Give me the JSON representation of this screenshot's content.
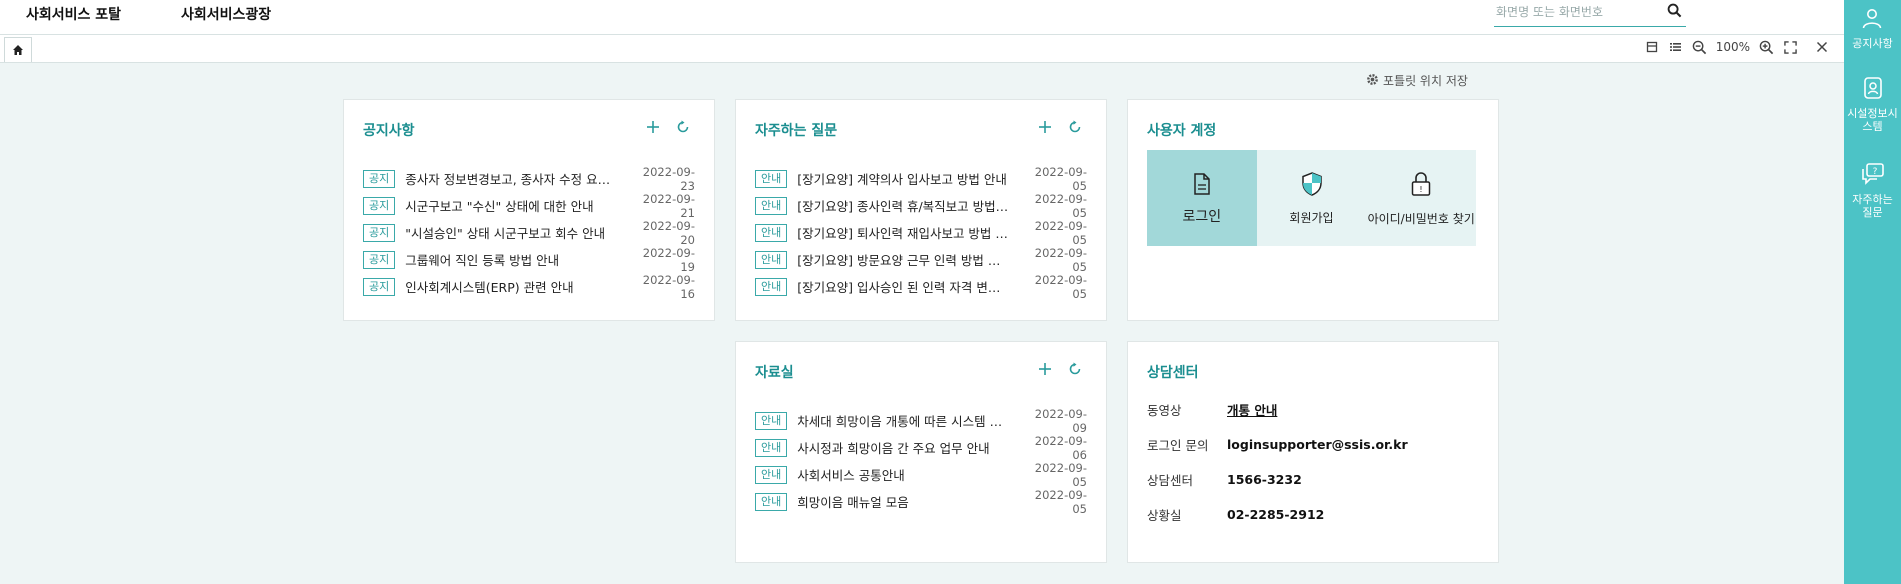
{
  "topnav": {
    "portal": "사회서비스 포탈",
    "plaza": "사회서비스광장"
  },
  "search": {
    "placeholder": "화면명 또는 화면번호",
    "value": ""
  },
  "toolbar": {
    "zoom": "100%"
  },
  "portlet": {
    "save_position": "포틀릿 위치 저장"
  },
  "rail": {
    "items": [
      {
        "label": "공지사항",
        "icon": "person-icon"
      },
      {
        "label": "시설정보시스템",
        "icon": "id-badge-icon"
      },
      {
        "label": "자주하는 질문",
        "icon": "chat-question-icon"
      }
    ]
  },
  "notices": {
    "title": "공지사항",
    "items": [
      {
        "badge": "공지",
        "text": "종사자 정보변경보고, 종사자 수정 요청 처리 안내",
        "date": "2022-09-23"
      },
      {
        "badge": "공지",
        "text": "시군구보고 \"수신\" 상태에 대한 안내",
        "date": "2022-09-21"
      },
      {
        "badge": "공지",
        "text": "\"시설승인\" 상태 시군구보고 회수 안내",
        "date": "2022-09-20"
      },
      {
        "badge": "공지",
        "text": "그룹웨어 직인 등록 방법 안내",
        "date": "2022-09-19"
      },
      {
        "badge": "공지",
        "text": "인사회계시스템(ERP) 관련 안내",
        "date": "2022-09-16"
      }
    ]
  },
  "faq": {
    "title": "자주하는 질문",
    "items": [
      {
        "badge": "안내",
        "text": "[장기요양] 계약의사 입사보고 방법 안내",
        "date": "2022-09-05"
      },
      {
        "badge": "안내",
        "text": "[장기요양] 종사인력 휴/복직보고 방법 안내",
        "date": "2022-09-05"
      },
      {
        "badge": "안내",
        "text": "[장기요양] 퇴사인력 재입사보고 방법 안내",
        "date": "2022-09-05"
      },
      {
        "badge": "안내",
        "text": "[장기요양] 방문요양 근무 인력 방법 안내",
        "date": "2022-09-05"
      },
      {
        "badge": "안내",
        "text": "[장기요양] 입사승인 된 인력 자격 변경 안내",
        "date": "2022-09-05"
      }
    ]
  },
  "account": {
    "title": "사용자 계정",
    "buttons": [
      {
        "label": "로그인",
        "icon": "document-icon"
      },
      {
        "label": "회원가입",
        "icon": "shield-icon"
      },
      {
        "label": "아이디/비밀번호 찾기",
        "icon": "lock-icon"
      }
    ]
  },
  "library": {
    "title": "자료실",
    "items": [
      {
        "badge": "안내",
        "text": "차세대 희망이음 개통에 따른 시스템 안내",
        "date": "2022-09-09"
      },
      {
        "badge": "안내",
        "text": "사시정과 희망이음 간 주요 업무 안내",
        "date": "2022-09-06"
      },
      {
        "badge": "안내",
        "text": "사회서비스 공통안내",
        "date": "2022-09-05"
      },
      {
        "badge": "안내",
        "text": "희망이음 매뉴얼 모음",
        "date": "2022-09-05"
      }
    ]
  },
  "center": {
    "title": "상담센터",
    "rows": [
      {
        "label": "동영상",
        "value": "개통 안내"
      },
      {
        "label": "로그인 문의",
        "value": "loginsupporter@ssis.or.kr"
      },
      {
        "label": "상담센터",
        "value": "1566-3232"
      },
      {
        "label": "상황실",
        "value": "02-2285-2912"
      }
    ]
  },
  "colors": {
    "accent": "#4cc3c6",
    "title": "#1b8e90",
    "badge": "#3aa9a9",
    "active": "#a2d8d9"
  }
}
